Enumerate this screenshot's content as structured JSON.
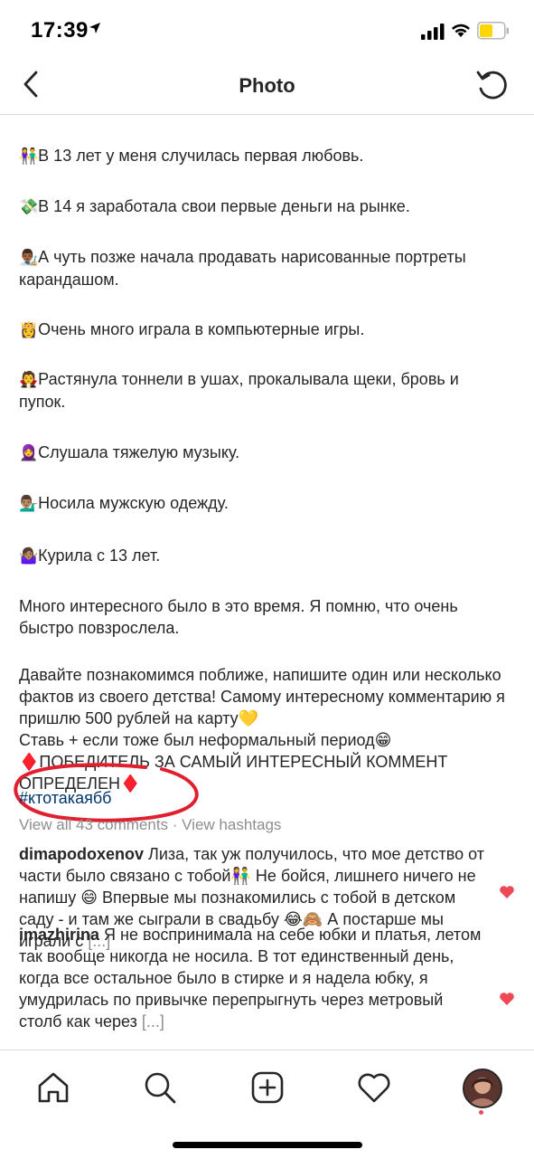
{
  "status": {
    "time": "17:39",
    "battery_color": "#ffd60a"
  },
  "nav": {
    "title": "Photo"
  },
  "post": {
    "paragraphs": [
      {
        "emoji": "👫",
        "text": "В 13 лет у меня случилась первая любовь."
      },
      {
        "emoji": "💸",
        "text": "В 14 я заработала свои первые деньги на рынке."
      },
      {
        "emoji": "👨🏾‍🎨",
        "text": "А чуть позже начала продавать нарисованные портреты карандашом."
      },
      {
        "emoji": "👸",
        "text": "Очень много играла в компьютерные игры."
      },
      {
        "emoji": "🧛",
        "text": "Растянула тоннели в ушах, прокалывала щеки, бровь и пупок."
      },
      {
        "emoji": "🧕",
        "text": "Слушала тяжелую музыку."
      },
      {
        "emoji": "💁🏽‍♂️",
        "text": "Носила мужскую одежду."
      },
      {
        "emoji": "🤷🏽‍♀️",
        "text": "Курила с 13 лет."
      },
      {
        "emoji": "",
        "text": "Много интересного было в это время. Я помню, что очень быстро повзрослела."
      }
    ],
    "final_block": "Давайте познакомимся поближе, напишите один или несколько фактов из своего детства! Самому интересному комментарию я пришлю 500 рублей на карту💛\nСтавь + если тоже был неформальный период😁\n♦️ПОБЕДИТЕЛЬ ЗА САМЫЙ ИНТЕРЕСНЫЙ КОММЕНТ ОПРЕДЕЛЕН♦️",
    "hashtag": "#ктотакаябб",
    "view_all": "View all 43 comments · View hashtags"
  },
  "comments": [
    {
      "user": "dimapodoxenov",
      "text": "Лиза, так уж получилось, что мое детство от части было связано с тобой👫 Не бойся, лишнего ничего не напишу 😄 Впервые мы познакомились с тобой в детском саду - и там же сыграли в свадьбу 😂🙈 А постарше мы играли с",
      "more": "[...]"
    },
    {
      "user": "imazhirina",
      "text": "Я не воспринимала на себе юбки и платья, летом так вообще никогда не носила. В тот единственный день, когда все остальное было в стирке и я надела юбку, я умудрилась по привычке перепрыгнуть через метровый столб как через",
      "more": "[...]"
    }
  ],
  "colors": {
    "hashtag": "#003569",
    "muted": "#8e8e8e",
    "heart": "#ed4956",
    "annotation_circle": "#e0202f"
  },
  "tabs": [
    "home-icon",
    "search-icon",
    "add-post-icon",
    "activity-heart-icon",
    "profile-avatar"
  ]
}
